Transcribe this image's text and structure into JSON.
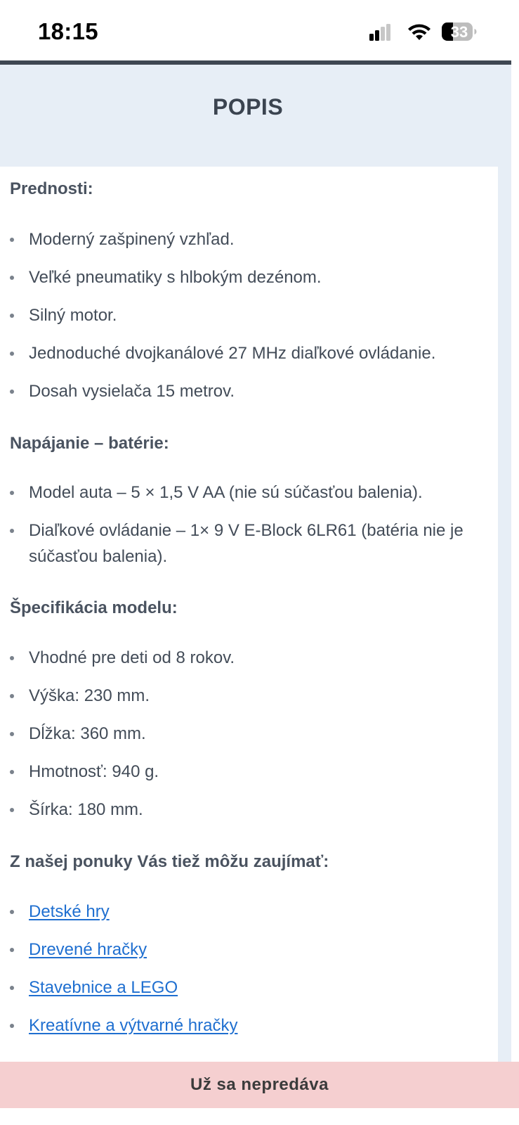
{
  "status_bar": {
    "time": "18:15",
    "battery": "33",
    "icons": [
      "cellular-signal-icon",
      "wifi-icon",
      "battery-icon"
    ]
  },
  "section": {
    "title": "POPIS"
  },
  "advantages": {
    "heading": "Prednosti:",
    "items": [
      "Moderný zašpinený vzhľad.",
      "Veľké pneumatiky s hlbokým dezénom.",
      "Silný motor.",
      "Jednoduché dvojkanálové 27 MHz diaľkové ovládanie.",
      "Dosah vysielača 15 metrov."
    ]
  },
  "power": {
    "heading": "Napájanie – batérie:",
    "items": [
      "Model auta – 5 × 1,5 V AA (nie sú súčasťou balenia).",
      "Diaľkové ovládanie – 1× 9 V E-Block 6LR61 (batéria nie je súčasťou balenia)."
    ]
  },
  "specs": {
    "heading": "Špecifikácia modelu:",
    "items": [
      "Vhodné pre deti od 8 rokov.",
      "Výška: 230 mm.",
      "Dĺžka: 360 mm.",
      "Hmotnosť: 940 g.",
      "Šírka: 180 mm."
    ]
  },
  "related": {
    "heading": "Z našej ponuky Vás tiež môžu zaujímať:",
    "links": [
      "Detské hry",
      "Drevené hračky",
      "Stavebnice a LEGO",
      "Kreatívne a výtvarné hračky"
    ]
  },
  "bottom_bar": {
    "label": "Už sa nepredáva"
  },
  "colors": {
    "page_background": "#e7eef6",
    "link": "#1f6fd0",
    "heading_text": "#4a5360",
    "bottom_bar": "#f5cfd0"
  }
}
